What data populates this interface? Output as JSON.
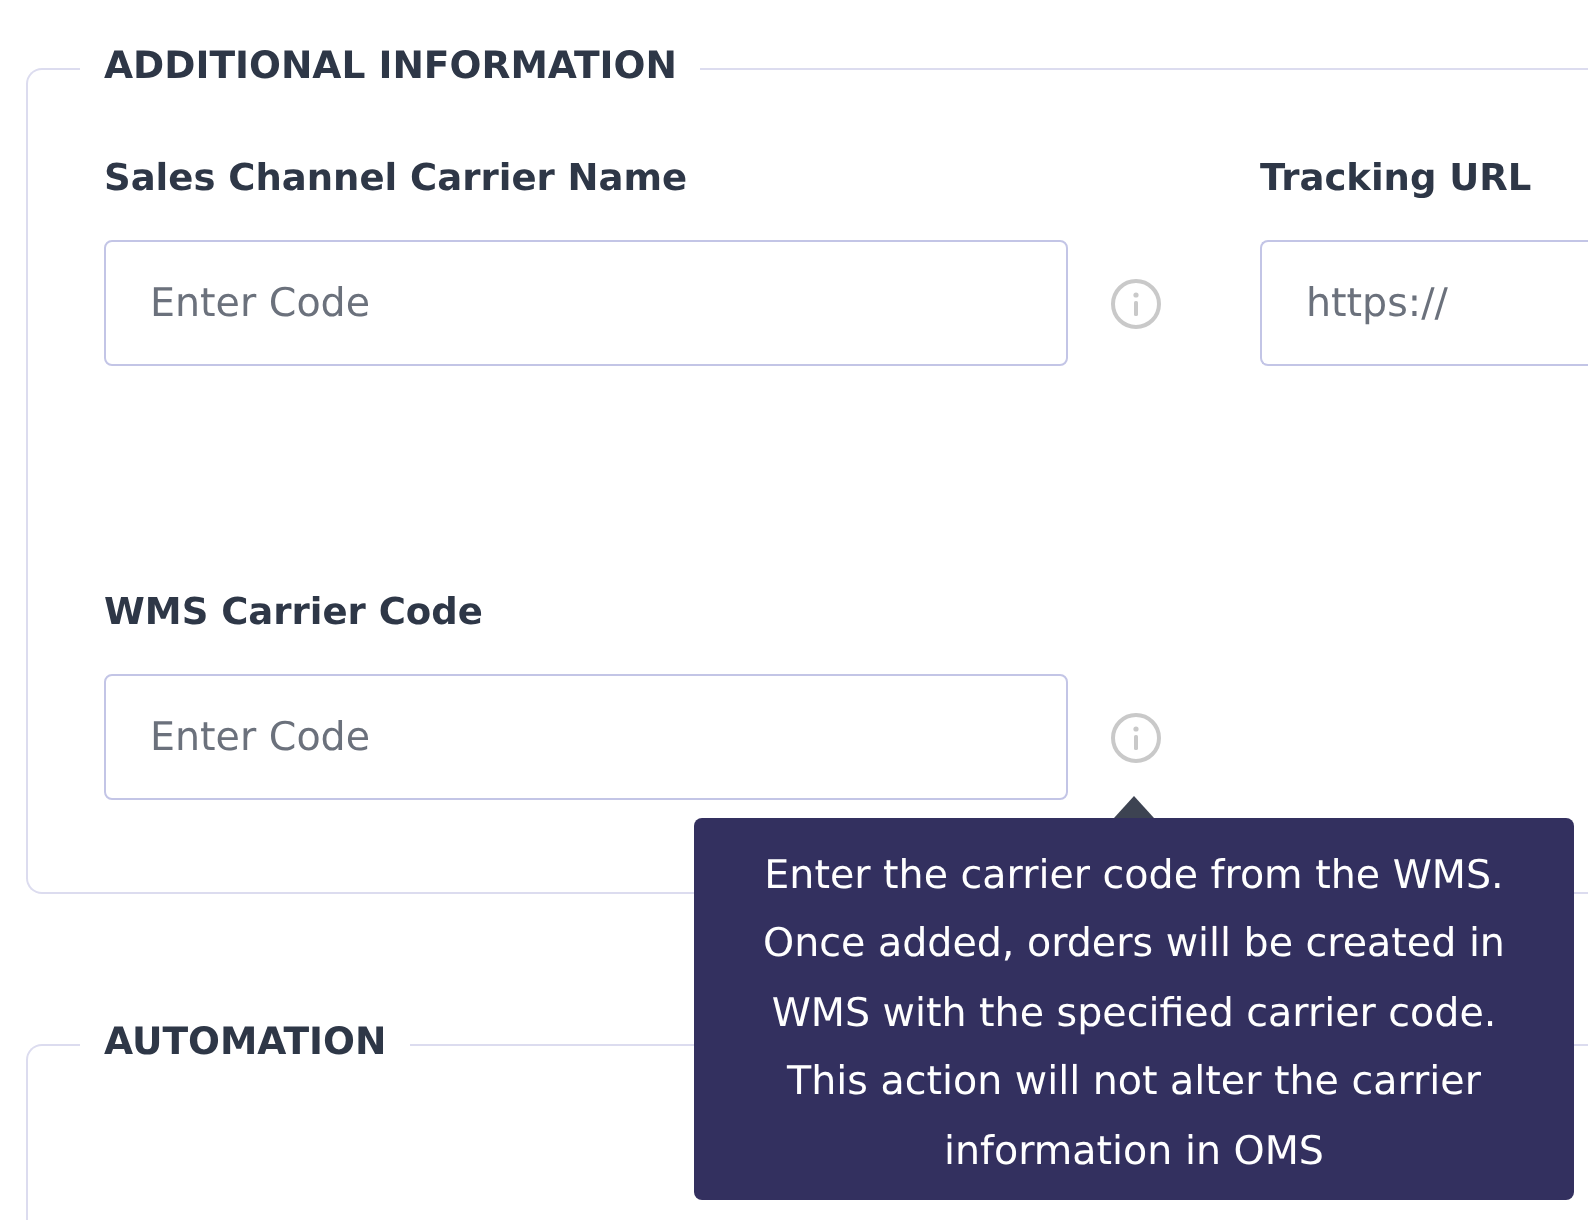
{
  "sections": [
    {
      "title": "ADDITIONAL INFORMATION",
      "fields": [
        {
          "label": "Sales Channel Carrier Name",
          "placeholder": "Enter Code",
          "info_icon": true
        },
        {
          "label": "Tracking URL",
          "placeholder": "https://",
          "info_icon": false
        },
        {
          "label": "WMS Carrier Code",
          "placeholder": "Enter Code",
          "info_icon": true,
          "tooltip": {
            "open": true,
            "text": "Enter the carrier code from the WMS. Once added, orders will be created in WMS with the specified carrier code. This action will not alter the carrier information in OMS"
          }
        }
      ]
    },
    {
      "title": "AUTOMATION"
    }
  ]
}
